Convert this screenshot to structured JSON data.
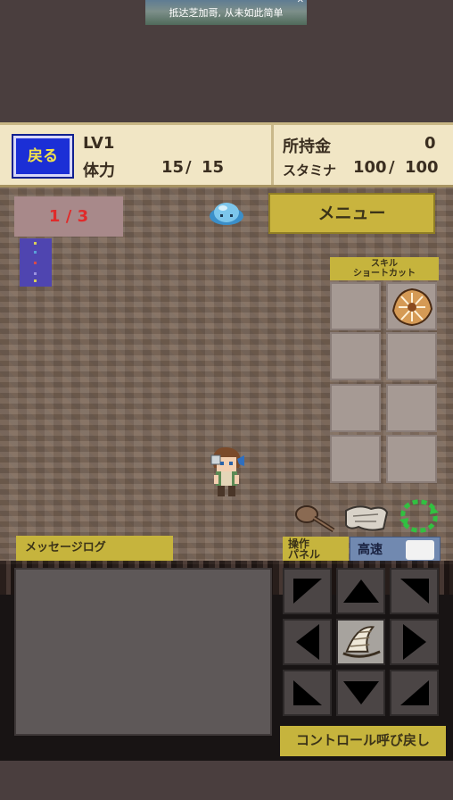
{
  "ad_banner": {
    "text": "抵达芝加哥, 从未如此简单",
    "icon": "close-x-icon"
  },
  "status": {
    "back_label": "戻る",
    "level_label": "LV1",
    "hp_label": "体力",
    "hp_current": "15",
    "hp_max": "15",
    "gold_label": "所持金",
    "gold_value": "0",
    "stamina_label": "スタミナ",
    "stamina_current": "100",
    "stamina_max": "100"
  },
  "floor": {
    "current": "1",
    "total": "3"
  },
  "menu_label": "メニュー",
  "skill_shortcut": {
    "line1": "スキル",
    "line2": "ショートカット"
  },
  "items_on_ground": [
    "wooden-club-icon",
    "cloth-map-icon"
  ],
  "message_log_label": "メッセージログ",
  "panel_label": {
    "line1": "操作",
    "line2": "パネル"
  },
  "speed_label": "高速",
  "control_recall_label": "コントロール呼び戻し",
  "colors": {
    "status_bg": "#f1e6c5",
    "back_button": "#1b2fd6",
    "accent_yellow": "#c6b43d",
    "floor_text": "#e02b2b",
    "minimap": "#4f45b0"
  }
}
